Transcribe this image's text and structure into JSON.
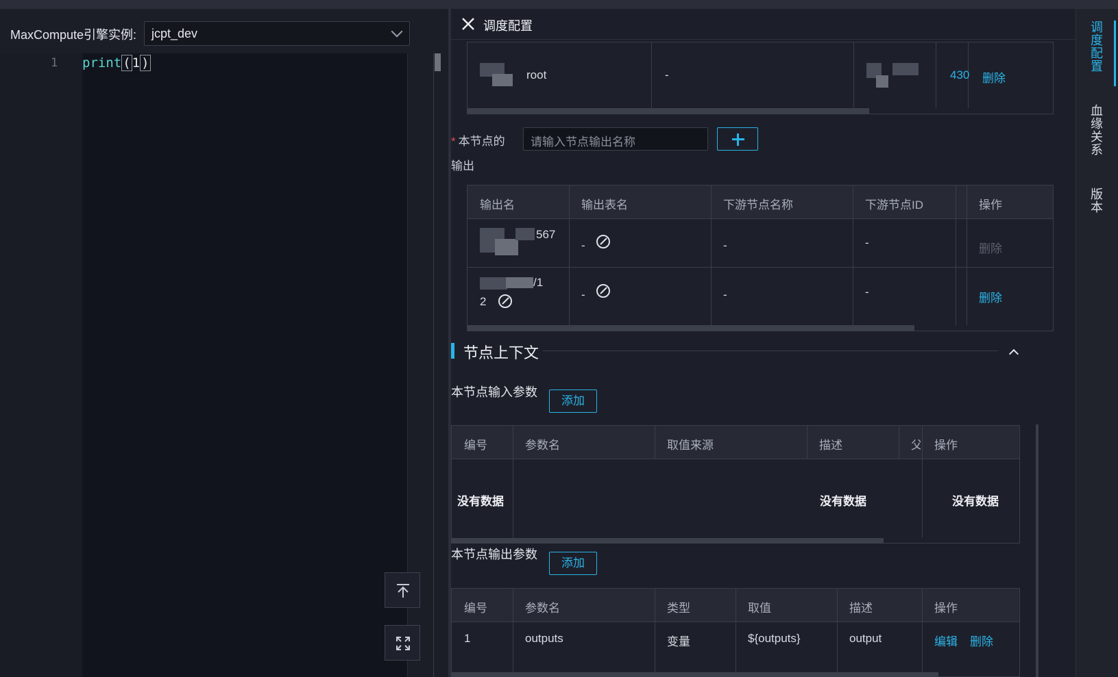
{
  "editor": {
    "engine_label": "MaxCompute引擎实例:",
    "engine_value": "jcpt_dev",
    "line_number": "1",
    "code_fn": "print",
    "code_open": "(",
    "code_arg": "1",
    "code_close": ")"
  },
  "panel": {
    "title": "调度配置",
    "top_table": {
      "row": {
        "owner_suffix": "root",
        "col2": "-",
        "col4": "430",
        "action": "删除"
      }
    },
    "output_form": {
      "label_line1": "本节点的",
      "label_line2": "输出",
      "required_mark": "*",
      "placeholder": "请输入节点输出名称"
    },
    "output_table": {
      "headers": [
        "输出名",
        "输出表名",
        "下游节点名称",
        "下游节点ID",
        "操作"
      ],
      "rows": [
        {
          "name_a": "567",
          "name_b": "",
          "table": "-",
          "downstream_name": "-",
          "downstream_id": "-",
          "action": "删除",
          "action_enabled": false
        },
        {
          "name_a": "/1",
          "name_b": "2",
          "table": "-",
          "downstream_name": "-",
          "downstream_id": "-",
          "action": "删除",
          "action_enabled": true
        }
      ]
    },
    "context_section": {
      "title": "节点上下文",
      "input_params": {
        "title": "本节点输入参数",
        "add_label": "添加",
        "headers": [
          "编号",
          "参数名",
          "取值来源",
          "描述",
          "父",
          "操作"
        ],
        "empty_text": "没有数据"
      },
      "output_params": {
        "title": "本节点输出参数",
        "add_label": "添加",
        "headers": [
          "编号",
          "参数名",
          "类型",
          "取值",
          "描述",
          "操作"
        ],
        "rows": [
          {
            "index": "1",
            "name": "outputs",
            "type": "变量",
            "value": "${outputs}",
            "desc": "output",
            "edit": "编辑",
            "delete": "删除"
          }
        ]
      }
    }
  },
  "rail": {
    "tabs": [
      {
        "label": "调度配置",
        "active": true
      },
      {
        "label": "血缘关系",
        "active": false
      },
      {
        "label": "版本",
        "active": false
      }
    ]
  },
  "colors": {
    "accent": "#2bb3e8",
    "required": "#e5484d",
    "background": "#1c1f29"
  }
}
